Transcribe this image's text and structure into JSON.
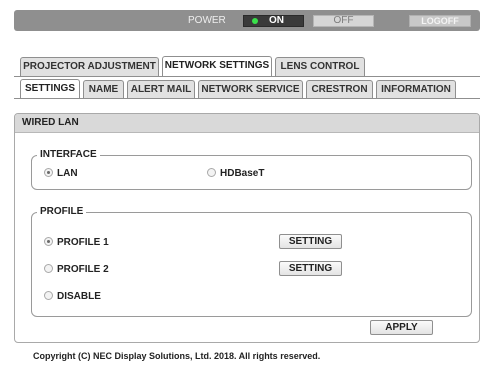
{
  "power_bar": {
    "label": "POWER",
    "on_label": "ON",
    "off_label": "OFF",
    "logoff_label": "LOGOFF",
    "on_indicator_color": "#39e04a"
  },
  "main_tabs": [
    {
      "label": "PROJECTOR ADJUSTMENT",
      "active": false
    },
    {
      "label": "NETWORK SETTINGS",
      "active": true
    },
    {
      "label": "LENS CONTROL",
      "active": false
    }
  ],
  "sub_tabs": [
    {
      "label": "SETTINGS",
      "active": true
    },
    {
      "label": "NAME",
      "active": false
    },
    {
      "label": "ALERT MAIL",
      "active": false
    },
    {
      "label": "NETWORK SERVICE",
      "active": false
    },
    {
      "label": "CRESTRON",
      "active": false
    },
    {
      "label": "INFORMATION",
      "active": false
    }
  ],
  "panel": {
    "title": "WIRED LAN",
    "interface": {
      "legend": "INTERFACE",
      "options": [
        {
          "label": "LAN",
          "selected": true
        },
        {
          "label": "HDBaseT",
          "selected": false
        }
      ]
    },
    "profile": {
      "legend": "PROFILE",
      "options": [
        {
          "label": "PROFILE 1",
          "selected": true
        },
        {
          "label": "PROFILE 2",
          "selected": false
        },
        {
          "label": "DISABLE",
          "selected": false
        }
      ],
      "setting_button_label": "SETTING"
    },
    "apply_label": "APPLY"
  },
  "footer": {
    "copyright": "Copyright (C) NEC Display Solutions, Ltd. 2018. All rights reserved."
  }
}
